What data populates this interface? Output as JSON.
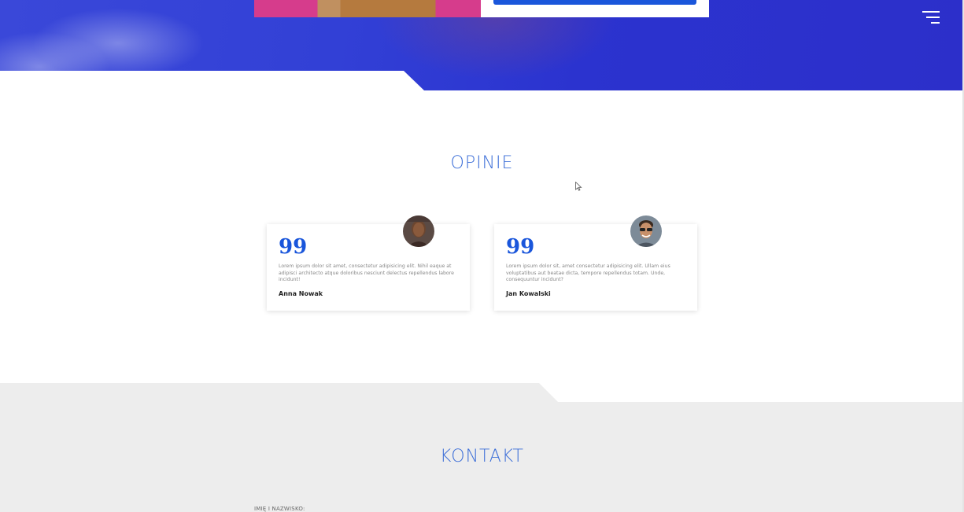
{
  "hero": {
    "menu_icon": "hamburger-menu-icon",
    "accent_color": "#2c3ad4"
  },
  "opinie": {
    "title": "OPINIE",
    "quote_icon": "quote-icon",
    "quote_glyph": "99",
    "testimonials": [
      {
        "text": "Lorem ipsum dolor sit amet, consectetur adipisicing elit. Nihil eaque at adipisci architecto atque doloribus nesciunt delectus repellendus labore incidunt!",
        "author": "Anna Nowak",
        "avatar_icon": "avatar-woman-icon"
      },
      {
        "text": "Lorem ipsum dolor sit, amet consectetur adipisicing elit. Ullam eius voluptatibus aut beatae dicta, tempore repellendus totam. Unde, consequuntur incidunt?",
        "author": "Jan Kowalski",
        "avatar_icon": "avatar-man-icon"
      }
    ],
    "accent_color": "#1a56db"
  },
  "kontakt": {
    "title": "KONTAKT",
    "name_label": "IMIĘ I NAZWISKO:"
  }
}
